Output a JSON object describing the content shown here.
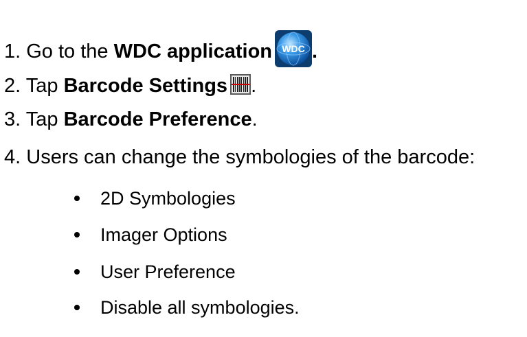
{
  "steps": [
    {
      "number": "1.",
      "prefix": "Go to the",
      "bold": "WDC application",
      "icon": "wdc-app-icon",
      "icon_text": "WDC",
      "suffix": "."
    },
    {
      "number": "2.",
      "prefix": "Tap",
      "bold": "Barcode Settings",
      "icon": "barcode-settings-icon",
      "suffix": "."
    },
    {
      "number": "3.",
      "prefix": "Tap",
      "bold": "Barcode Preference",
      "suffix": "."
    },
    {
      "number": "4.",
      "text": "Users can change the symbologies of the barcode:"
    }
  ],
  "bullets": [
    "2D Symbologies",
    "Imager Options",
    "User Preference",
    "Disable all symbologies."
  ],
  "colors": {
    "text": "#000000",
    "icon_blue": "#1e7fd6",
    "barcode_red": "#cc0000"
  }
}
